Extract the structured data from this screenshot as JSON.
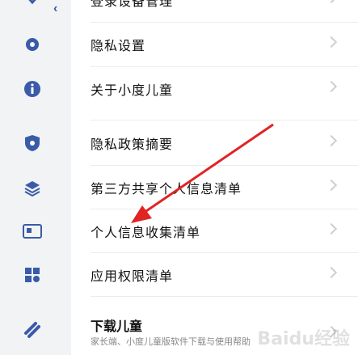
{
  "rows": [
    {
      "label": "登录设备管理"
    },
    {
      "label": "隐私设置"
    },
    {
      "label": "关于小度儿童"
    },
    {
      "label": "隐私政策摘要"
    },
    {
      "label": "第三方共享个人信息清单"
    },
    {
      "label": "个人信息收集清单"
    },
    {
      "label": "应用权限清单"
    }
  ],
  "section": {
    "title": "下载儿童",
    "desc": "家长端、小度儿童版软件下载与使用帮助"
  },
  "watermark": "Baidu经验",
  "colors": {
    "accent": "#3a5ba8",
    "arrow": "#e02424"
  }
}
